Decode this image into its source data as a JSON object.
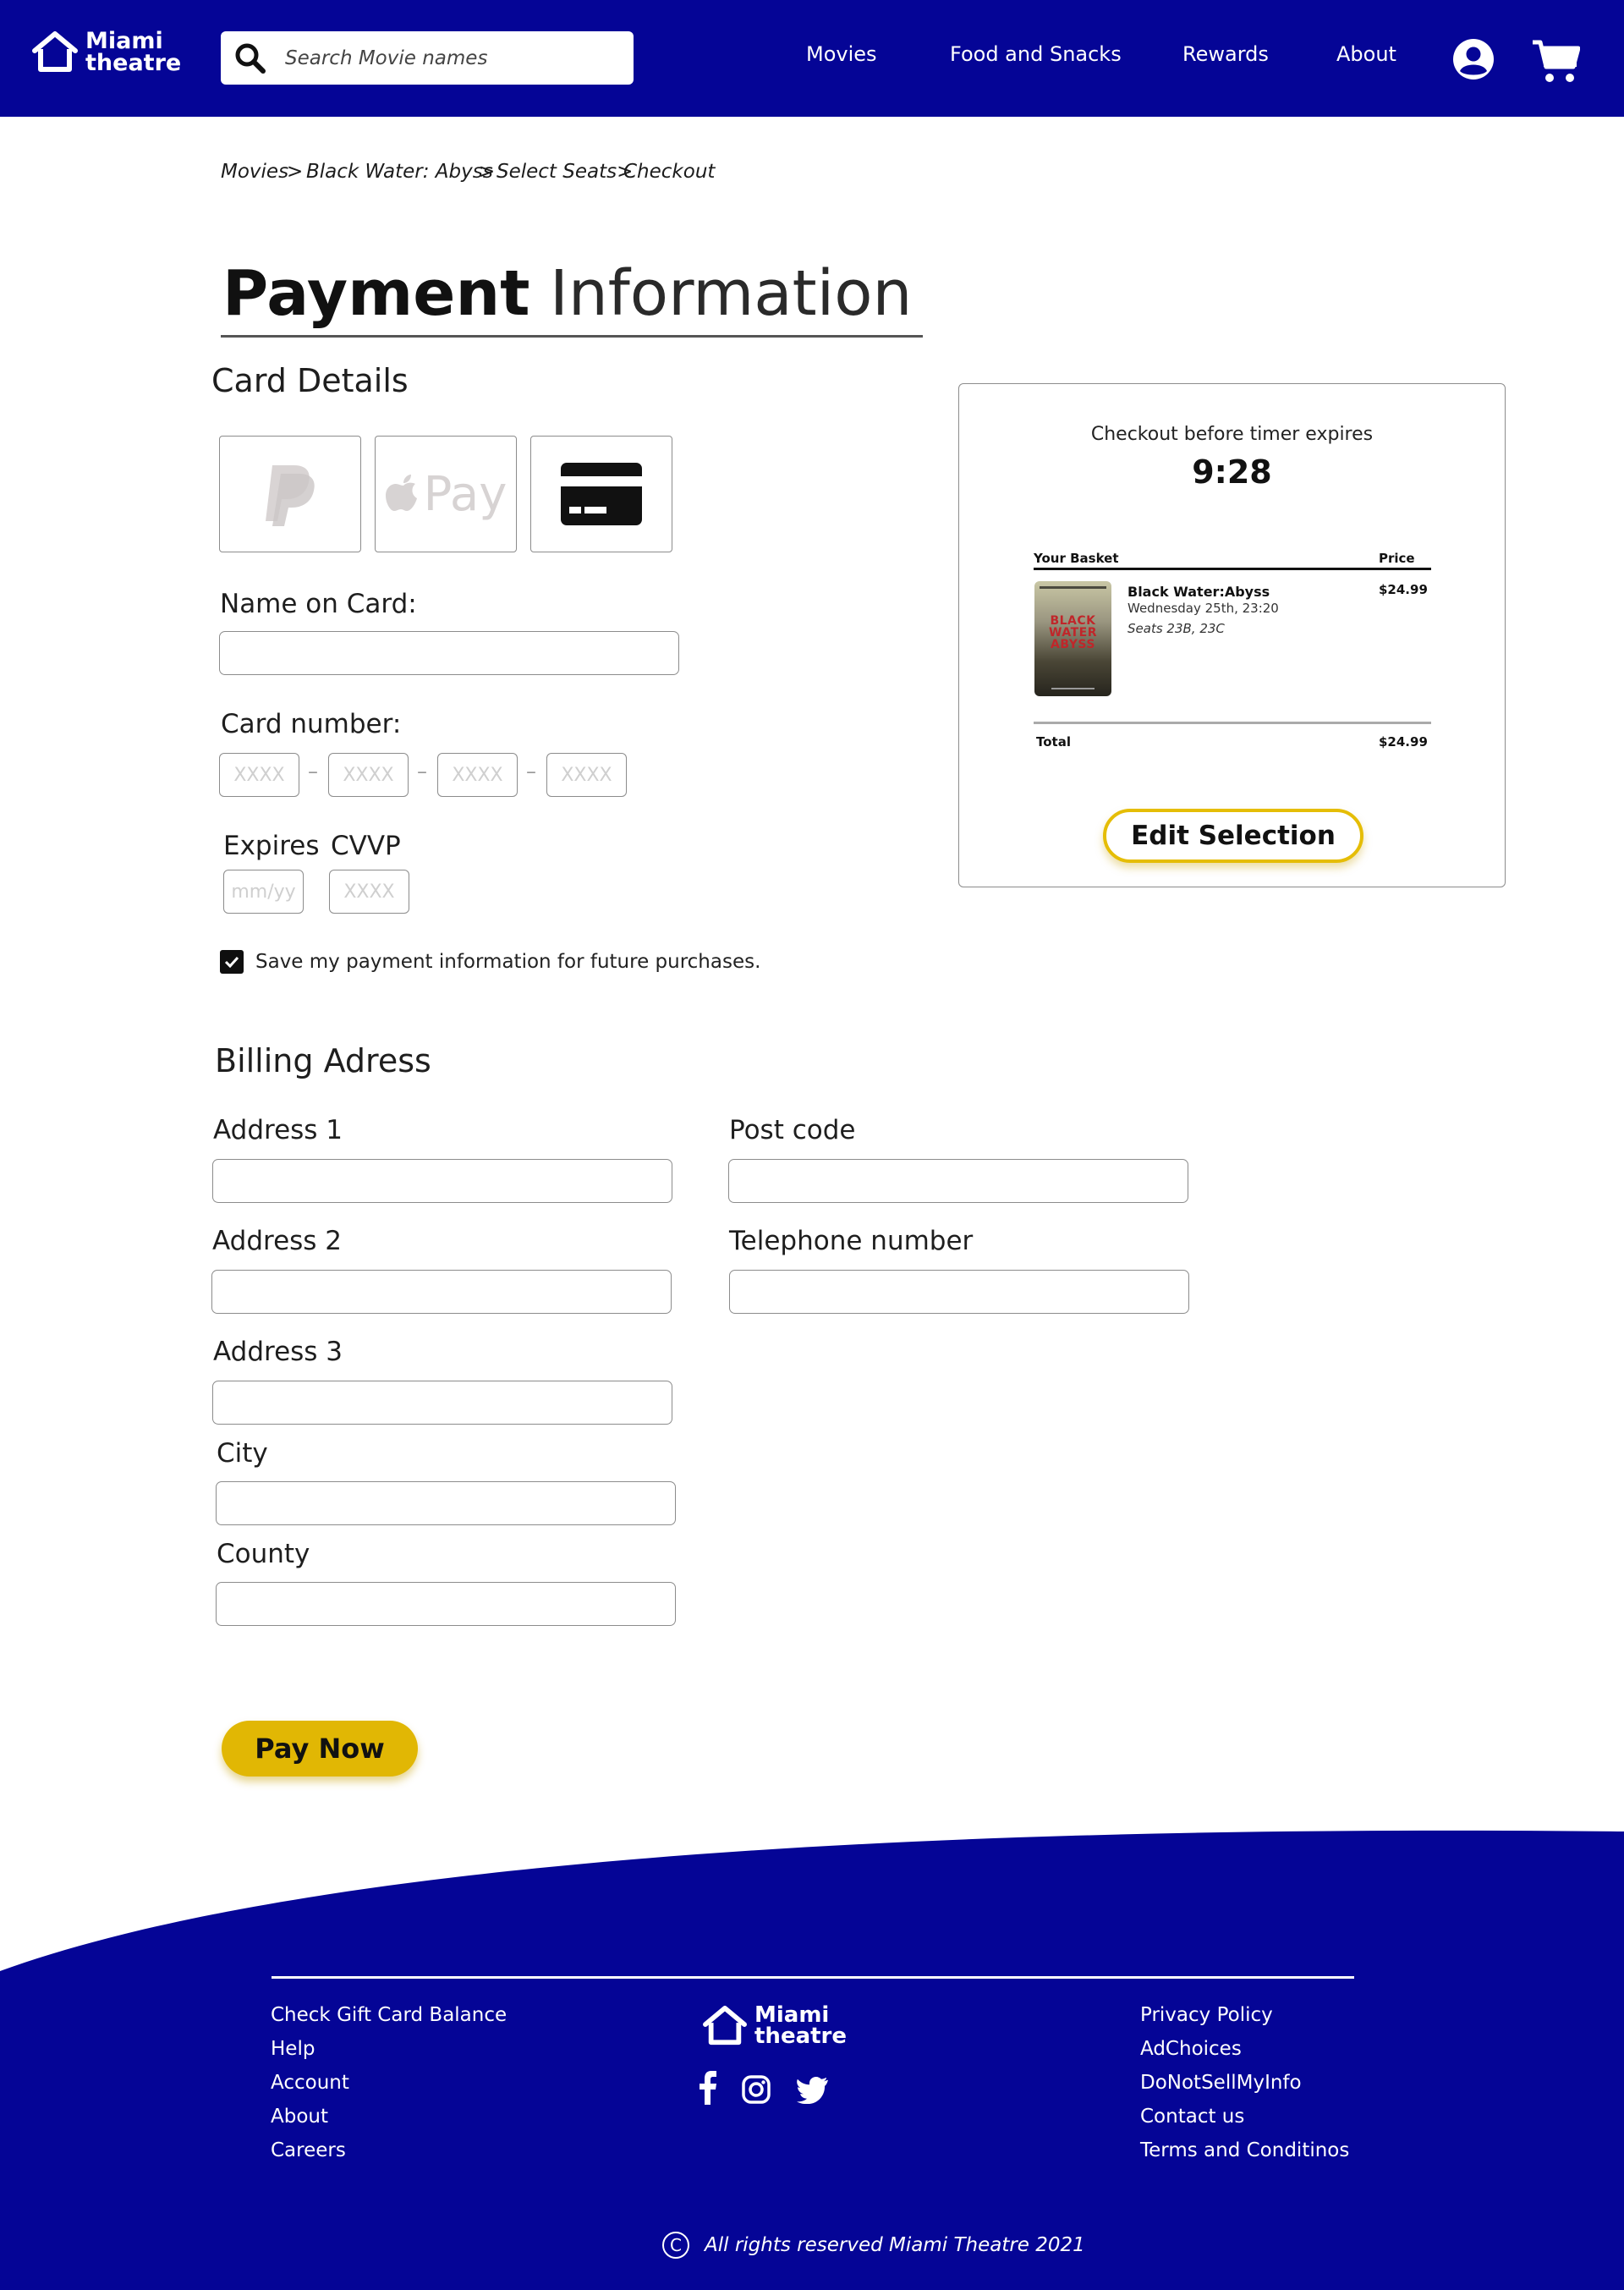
{
  "brand": {
    "line1": "Miami",
    "line2": "theatre"
  },
  "search": {
    "placeholder": "Search Movie names"
  },
  "nav": [
    "Movies",
    "Food and Snacks",
    "Rewards",
    "About"
  ],
  "breadcrumb": [
    "Movies",
    ">",
    "Black Water: Abyss",
    ">",
    "Select Seats>",
    "Checkout"
  ],
  "page_title": {
    "bold": "Payment",
    "light": "Information"
  },
  "card_details": {
    "heading": "Card Details",
    "payment_methods": [
      "paypal-icon",
      "apple-pay-icon",
      "credit-card-icon"
    ],
    "apple_pay_label": "Pay",
    "name_label": "Name on Card:",
    "number_label": "Card number:",
    "number_placeholder": "XXXX",
    "number_separator": "–",
    "expires_label": "Expires",
    "expires_placeholder": "mm/yy",
    "cvv_label": "CVVP",
    "cvv_placeholder": "XXXX",
    "save_checked": true,
    "save_label": "Save my payment information for future purchases."
  },
  "billing": {
    "heading": "Billing Adress",
    "address1": "Address 1",
    "address2": "Address 2",
    "address3": "Address 3",
    "city": "City",
    "county": "County",
    "postcode": "Post code",
    "telephone": "Telephone number"
  },
  "pay_button": "Pay Now",
  "basket": {
    "timer_text": "Checkout before timer expires",
    "timer": "9:28",
    "col_basket": "Your Basket",
    "col_price": "Price",
    "poster_title": "BLACK WATER ABYSS",
    "item": {
      "title": "Black Water:Abyss",
      "date": "Wednesday 25th, 23:20",
      "seats": "Seats 23B, 23C",
      "price": "$24.99"
    },
    "total_label": "Total",
    "total_value": "$24.99",
    "edit_button": "Edit Selection"
  },
  "footer": {
    "left_links": [
      "Check Gift Card Balance",
      "Help",
      "Account",
      "About",
      "Careers"
    ],
    "right_links": [
      "Privacy Policy",
      "AdChoices",
      "DoNotSellMyInfo",
      "Contact us",
      "Terms and Conditinos"
    ],
    "social": [
      "facebook-icon",
      "instagram-icon",
      "twitter-icon"
    ],
    "copyright_symbol": "C",
    "copyright": "All rights reserved Miami Theatre 2021"
  },
  "colors": {
    "header_bg": "#050596",
    "accent": "#e1b704",
    "footer_bg": "#050596"
  }
}
